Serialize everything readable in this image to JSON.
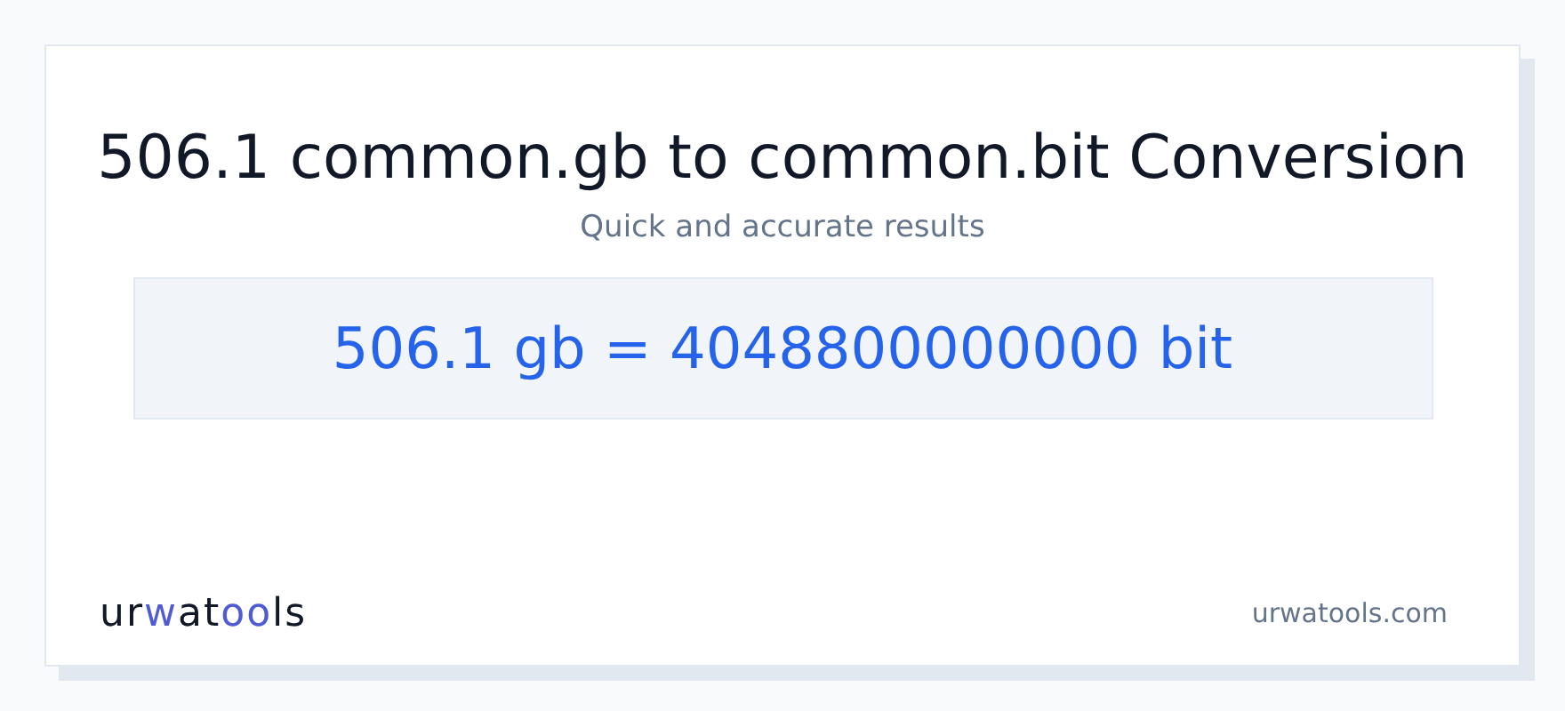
{
  "title": "506.1 common.gb to common.bit Conversion",
  "subtitle": "Quick and accurate results",
  "result": "506.1 gb = 4048800000000 bit",
  "logo": [
    {
      "text": "ur",
      "accent": false
    },
    {
      "text": "w",
      "accent": true
    },
    {
      "text": "at",
      "accent": false
    },
    {
      "text": "oo",
      "accent": true
    },
    {
      "text": "ls",
      "accent": false
    }
  ],
  "site": "urwatools.com"
}
